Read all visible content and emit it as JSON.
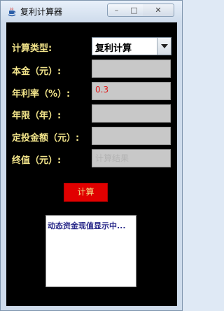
{
  "window": {
    "title": "复利计算器",
    "controls": {
      "minimize": "–",
      "maximize": "□",
      "close": "✕"
    }
  },
  "form": {
    "calc_type": {
      "label": "计算类型:",
      "selected": "复利计算"
    },
    "principal": {
      "label": "本金（元）:",
      "value": ""
    },
    "annual_rate": {
      "label": "年利率（%）:",
      "value": "0.3"
    },
    "years": {
      "label": "年限（年）:",
      "value": ""
    },
    "fixed_investment": {
      "label": "定投金额（元）:",
      "value": ""
    },
    "final_value": {
      "label": "终值（元）:",
      "placeholder": "计算结果"
    }
  },
  "actions": {
    "calculate_label": "计算"
  },
  "result_panel": {
    "text": "动态资金现值显示中..."
  },
  "colors": {
    "background": "#000000",
    "label": "#f2e48a",
    "button": "#e10000",
    "field": "#c8c8c8"
  }
}
